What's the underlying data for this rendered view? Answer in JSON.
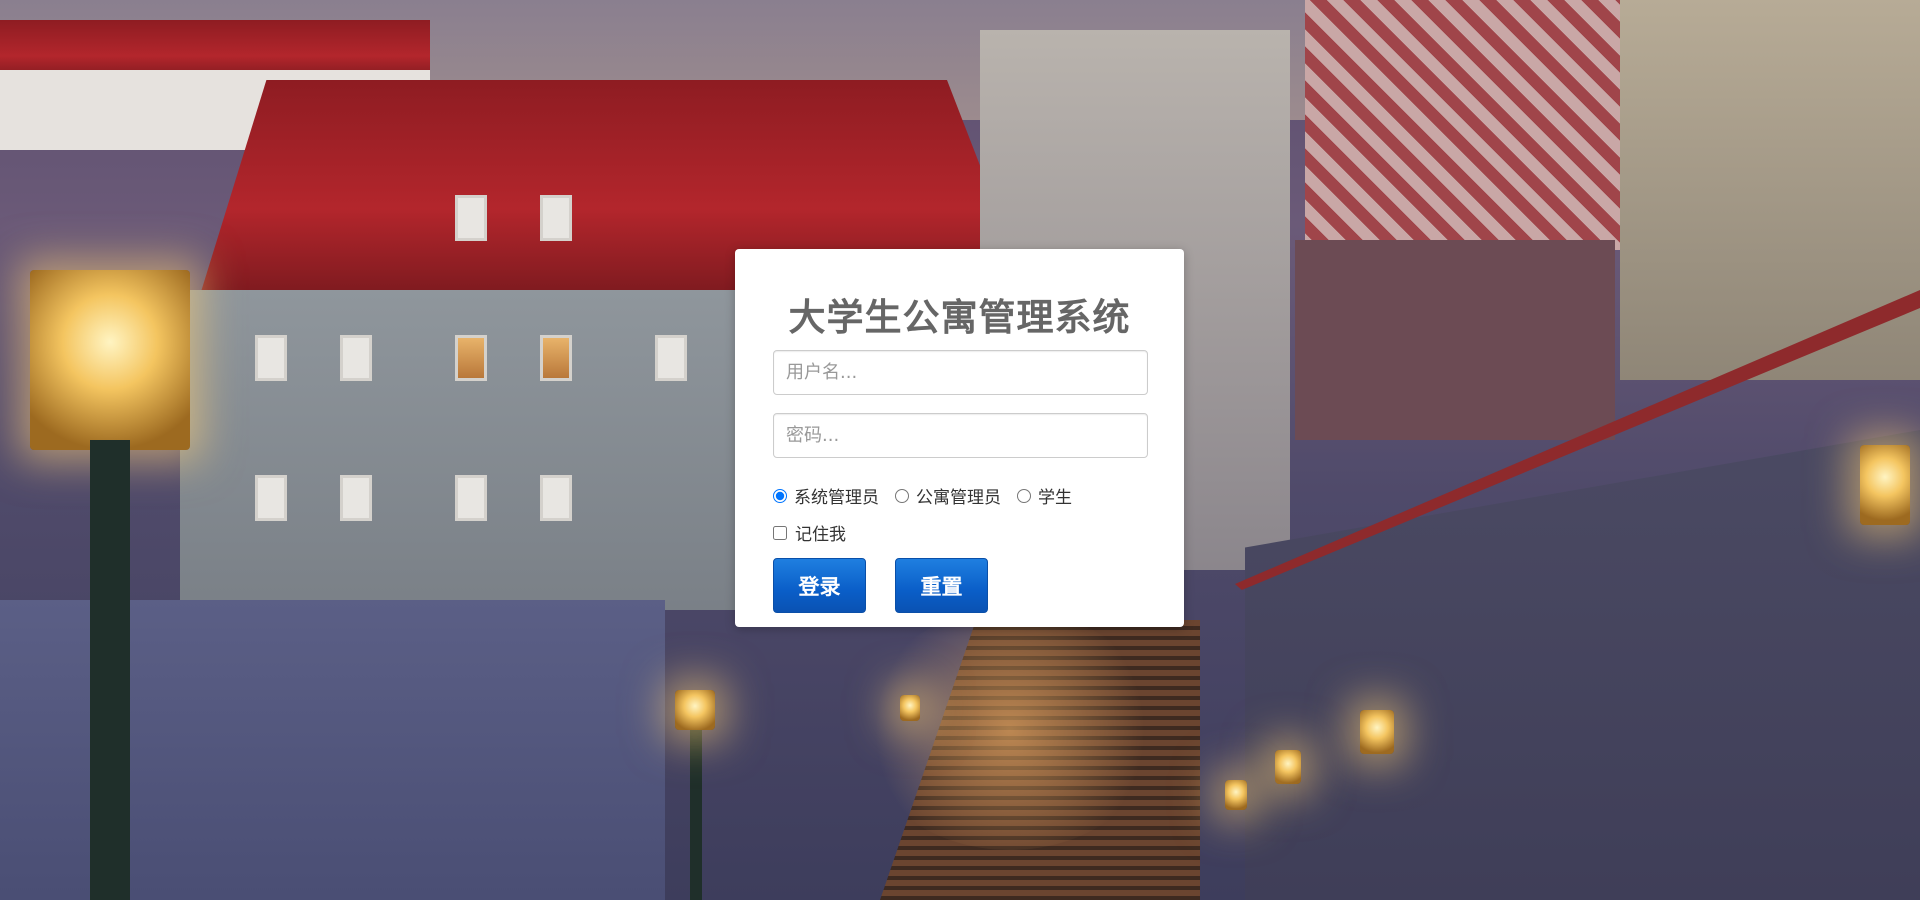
{
  "login_card": {
    "title": "大学生公寓管理系统",
    "username_placeholder": "用户名...",
    "password_placeholder": "密码...",
    "roles": [
      {
        "label": "系统管理员",
        "selected": true
      },
      {
        "label": "公寓管理员",
        "selected": false
      },
      {
        "label": "学生",
        "selected": false
      }
    ],
    "remember_label": "记住我",
    "remember_checked": false,
    "login_label": "登录",
    "reset_label": "重置"
  },
  "colors": {
    "button_primary": "#0a5ec8",
    "title_text": "#666666",
    "card_background": "#ffffff"
  }
}
